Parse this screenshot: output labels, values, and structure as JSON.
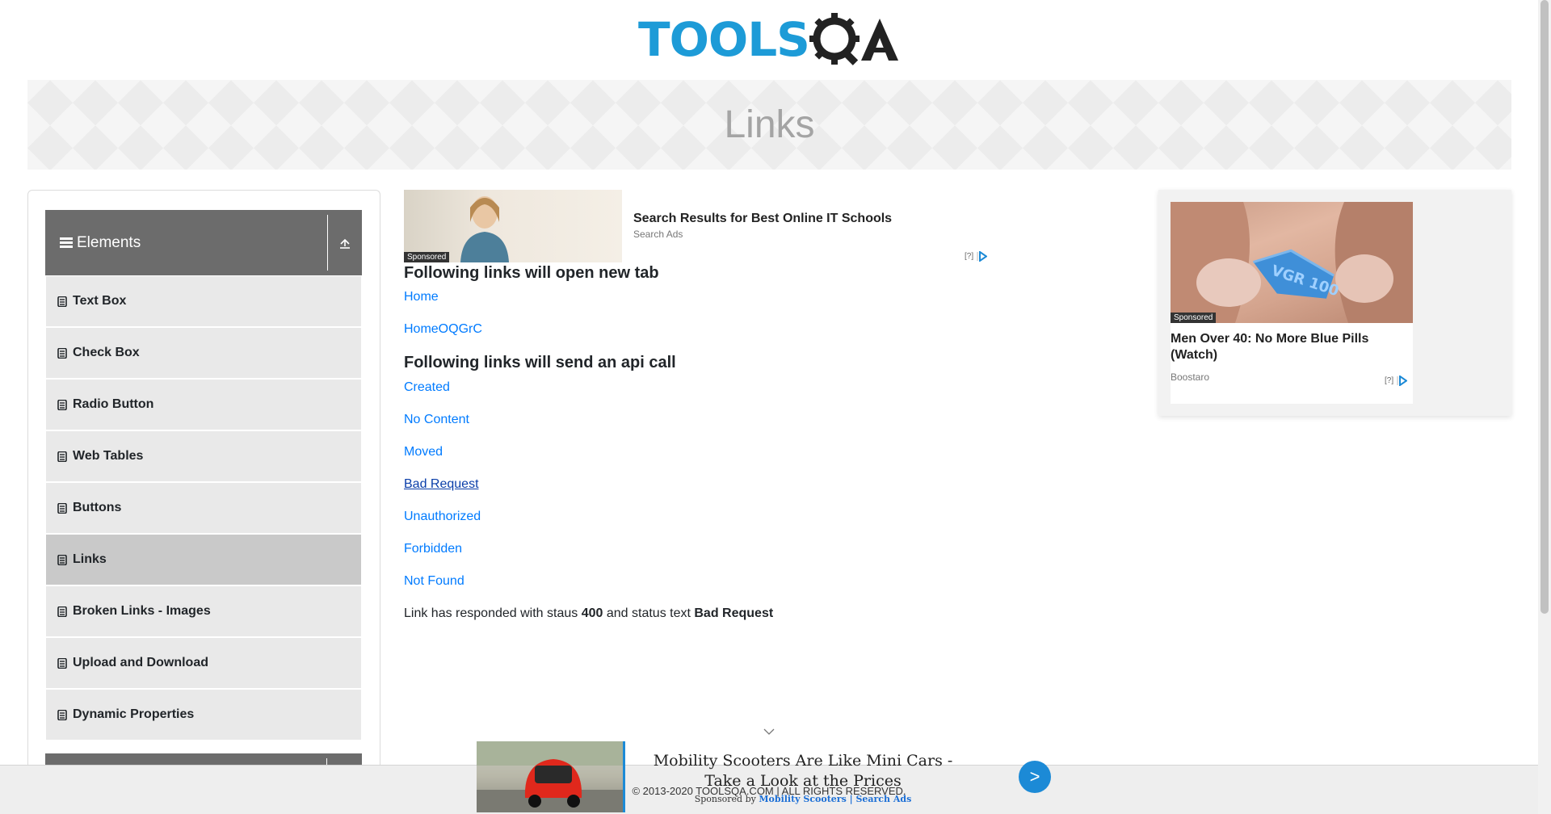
{
  "header": {
    "logo_text": "TOOLS",
    "logo_qa": "QA"
  },
  "banner": {
    "title": "Links"
  },
  "sidebar": {
    "group_title": "Elements",
    "items": [
      {
        "label": "Text Box",
        "active": false
      },
      {
        "label": "Check Box",
        "active": false
      },
      {
        "label": "Radio Button",
        "active": false
      },
      {
        "label": "Web Tables",
        "active": false
      },
      {
        "label": "Buttons",
        "active": false
      },
      {
        "label": "Links",
        "active": true
      },
      {
        "label": "Broken Links - Images",
        "active": false
      },
      {
        "label": "Upload and Download",
        "active": false
      },
      {
        "label": "Dynamic Properties",
        "active": false
      }
    ]
  },
  "ad_top": {
    "sponsored": "Sponsored",
    "title": "Search Results for Best Online IT Schools",
    "source": "Search Ads",
    "adchoice": "[?]"
  },
  "main": {
    "new_tab_heading": "Following links will open new tab",
    "new_tab_links": [
      "Home",
      "HomeOQGrC"
    ],
    "api_heading": "Following links will send an api call",
    "api_links": [
      "Created",
      "No Content",
      "Moved",
      "Bad Request",
      "Unauthorized",
      "Forbidden",
      "Not Found"
    ],
    "response": {
      "prefix": "Link has responded with staus",
      "status_code": "400",
      "middle": "and status text",
      "status_text": "Bad Request"
    }
  },
  "ad_right": {
    "sponsored": "Sponsored",
    "pill_text": "VGR 100",
    "title": "Men Over 40: No More Blue Pills (Watch)",
    "source": "Boostaro",
    "adchoice": "[?]"
  },
  "footer": {
    "copyright": "© 2013-2020 TOOLSQA.COM | ALL RIGHTS RESERVED."
  },
  "sticky_ad": {
    "title": "Mobility Scooters Are Like Mini Cars - Take a Look at the Prices",
    "sponsored_by": "Sponsored by",
    "sponsor": "Mobility Scooters | Search Ads",
    "next_label": ">"
  },
  "colors": {
    "link": "#007bff",
    "visited_link": "#0a3ea9",
    "brand_blue": "#1d9bd7",
    "sidebar_header": "#6c6c6c"
  }
}
